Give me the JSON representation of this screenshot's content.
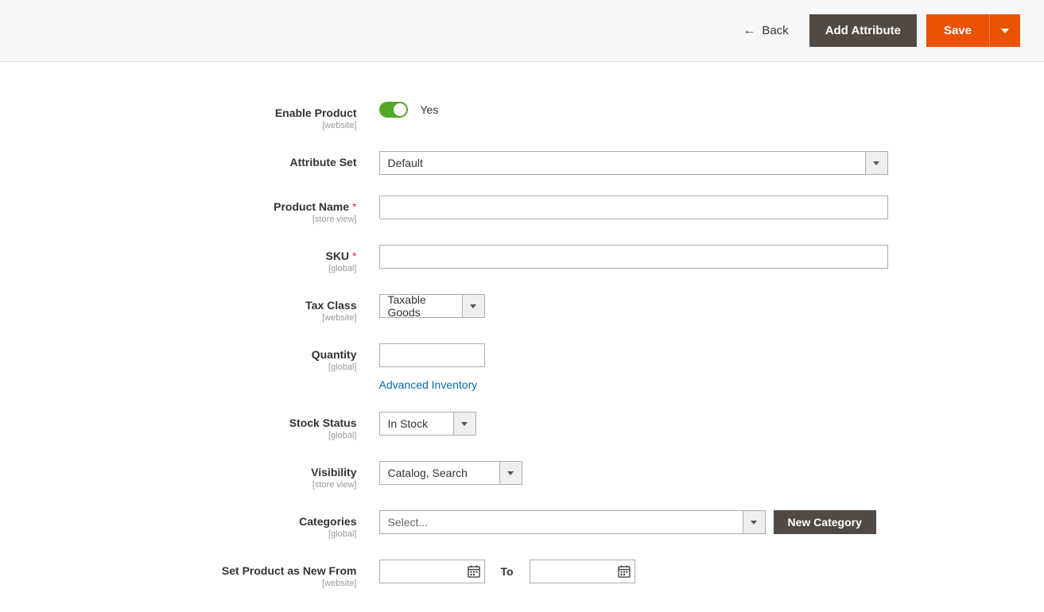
{
  "header": {
    "back_label": "Back",
    "add_attribute_label": "Add Attribute",
    "save_label": "Save"
  },
  "fields": {
    "enable_product": {
      "label": "Enable Product",
      "scope": "[website]",
      "value_label": "Yes"
    },
    "attribute_set": {
      "label": "Attribute Set",
      "value": "Default"
    },
    "product_name": {
      "label": "Product Name",
      "scope": "[store view]",
      "value": ""
    },
    "sku": {
      "label": "SKU",
      "scope": "[global]",
      "value": ""
    },
    "tax_class": {
      "label": "Tax Class",
      "scope": "[website]",
      "value": "Taxable Goods"
    },
    "quantity": {
      "label": "Quantity",
      "scope": "[global]",
      "value": "",
      "advanced_link": "Advanced Inventory"
    },
    "stock_status": {
      "label": "Stock Status",
      "scope": "[global]",
      "value": "In Stock"
    },
    "visibility": {
      "label": "Visibility",
      "scope": "[store view]",
      "value": "Catalog, Search"
    },
    "categories": {
      "label": "Categories",
      "scope": "[global]",
      "placeholder": "Select...",
      "new_category_label": "New Category"
    },
    "new_from": {
      "label": "Set Product as New From",
      "scope": "[website]",
      "from_value": "",
      "to_label": "To",
      "to_value": ""
    }
  }
}
